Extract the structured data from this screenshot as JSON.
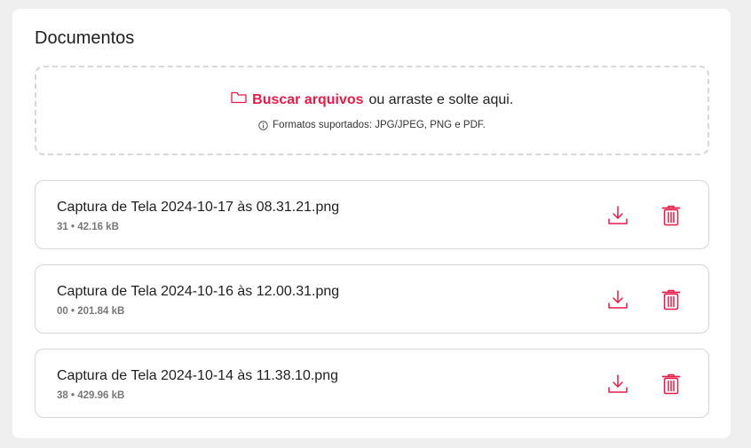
{
  "section": {
    "title": "Documentos"
  },
  "dropzone": {
    "link_label": "Buscar arquivos",
    "instruction": "ou arraste e solte aqui.",
    "formats": "Formatos suportados:  JPG/JPEG, PNG e PDF."
  },
  "files": [
    {
      "name": "Captura de Tela 2024-10-17 às 08.31.21.png",
      "meta": "31 • 42.16 kB"
    },
    {
      "name": "Captura de Tela 2024-10-16 às 12.00.31.png",
      "meta": "00 • 201.84 kB"
    },
    {
      "name": "Captura de Tela 2024-10-14 às 11.38.10.png",
      "meta": "38 • 429.96 kB"
    }
  ],
  "colors": {
    "accent": "#e11d48",
    "border": "#d6d6d6",
    "background": "#efefef"
  },
  "icons": {
    "download": "download-icon",
    "delete": "trash-icon",
    "folder": "folder-icon",
    "info": "info-icon"
  }
}
